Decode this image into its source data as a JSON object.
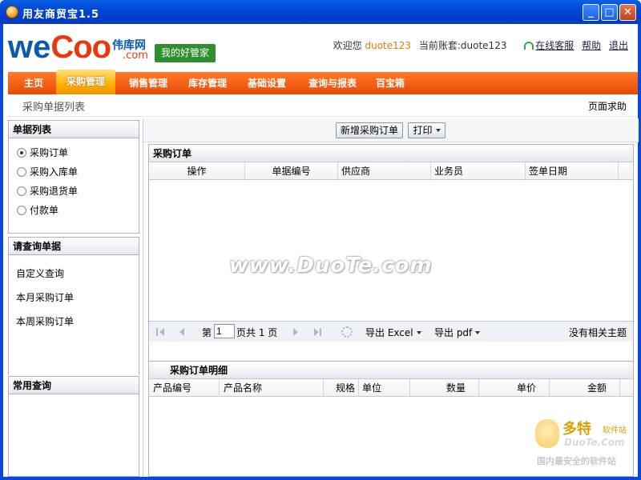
{
  "window": {
    "title": "用友商贸宝1.5",
    "min": "_",
    "max": "□",
    "close": "✕"
  },
  "header": {
    "logo_we": "we",
    "logo_coo": "Coo",
    "logo_sub": "伟库网",
    "logo_com": ".com",
    "slogan": "我的好管家",
    "welcome": "欢迎您",
    "username": "duote123",
    "account_label": "当前账套:",
    "account": "duote123",
    "online_service": "在线客服",
    "help": "帮助",
    "logout": "退出"
  },
  "nav": {
    "items": [
      {
        "label": "主页"
      },
      {
        "label": "采购管理"
      },
      {
        "label": "销售管理"
      },
      {
        "label": "库存管理"
      },
      {
        "label": "基础设置"
      },
      {
        "label": "查询与报表"
      },
      {
        "label": "百宝箱"
      }
    ],
    "active_index": 1
  },
  "subhead": {
    "breadcrumb": "采购单据列表",
    "help": "页面求助"
  },
  "doc_list": {
    "title": "单据列表",
    "items": [
      "采购订单",
      "采购入库单",
      "采购退货单",
      "付款单"
    ],
    "selected_index": 0
  },
  "query": {
    "title": "请查询单据",
    "items": [
      "自定义查询",
      "本月采购订单",
      "本周采购订单"
    ]
  },
  "common_query": {
    "title": "常用查询"
  },
  "toolbar": {
    "new_order": "新增采购订单",
    "print": "打印"
  },
  "order_grid": {
    "title": "采购订单",
    "columns": [
      "操作",
      "单据编号",
      "供应商",
      "业务员",
      "签单日期"
    ]
  },
  "pager": {
    "page_prefix": "第",
    "page_value": "1",
    "page_suffix": "页共 1 页",
    "export_excel": "导出 Excel",
    "export_pdf": "导出 pdf",
    "empty_text": "没有相关主题"
  },
  "detail_grid": {
    "title": "采购订单明细",
    "columns": [
      "产品编号",
      "产品名称",
      "规格",
      "单位",
      "数量",
      "单价",
      "金额"
    ]
  },
  "watermark": "www.DuoTe.com",
  "corner_mark": {
    "big": "多特",
    "small": "软件站",
    "url": "DuoTe.Com",
    "tag": "国内最安全的软件站"
  },
  "colors": {
    "title_bar": "#0047d6",
    "nav_orange": "#e84a08",
    "nav_active": "#ffb000",
    "slogan_green": "#2e8f2e",
    "logo_blue": "#0a5bb0",
    "logo_red": "#e8380c"
  }
}
